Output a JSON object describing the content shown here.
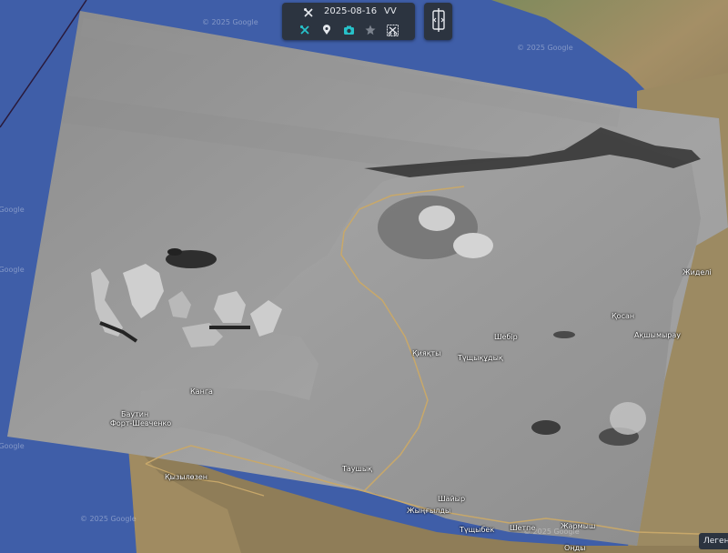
{
  "toolbar": {
    "date": "2025-08-16",
    "polarization": "VV",
    "icons": [
      "tools-icon",
      "tools-active-icon",
      "pin-icon",
      "camera-icon",
      "star-icon",
      "scissors-icon"
    ]
  },
  "split_button": {
    "icon": "split-view-icon"
  },
  "watermarks": {
    "w1": "© 2025 Google",
    "w2": "© 2025 Google",
    "w3": "© 2025 Google",
    "w4": "© 2025 Google",
    "w5": "© 2025 Google",
    "w6": "© 2025 Google",
    "w7": "© 2025 Google"
  },
  "places": {
    "kanga": "Канга",
    "bautin": "Баутин",
    "fort": "Форт-Шевченко",
    "kyzylozen": "Қызылөзен",
    "tauchik": "Таушық",
    "shaiyr1": "Шайыр",
    "zhyngyldy": "Жыңғылды",
    "tushybek": "Түщыбек",
    "shetpe": "Шетпе",
    "zharmysh": "Жармыш",
    "ondy": "Оңды",
    "kiyakty": "Қияқты",
    "tushykudyk": "Түщықұдық",
    "shebir": "Шебір",
    "kosan": "Қосан",
    "akshymyrau": "Ақшымырау",
    "zhidely": "Жиделі"
  },
  "legend": {
    "label": "Легенда"
  },
  "colors": {
    "toolbar_bg": "#2c3440",
    "accent": "#27c1c9",
    "sea": "#3f5ea8",
    "road": "#c8a86a"
  }
}
